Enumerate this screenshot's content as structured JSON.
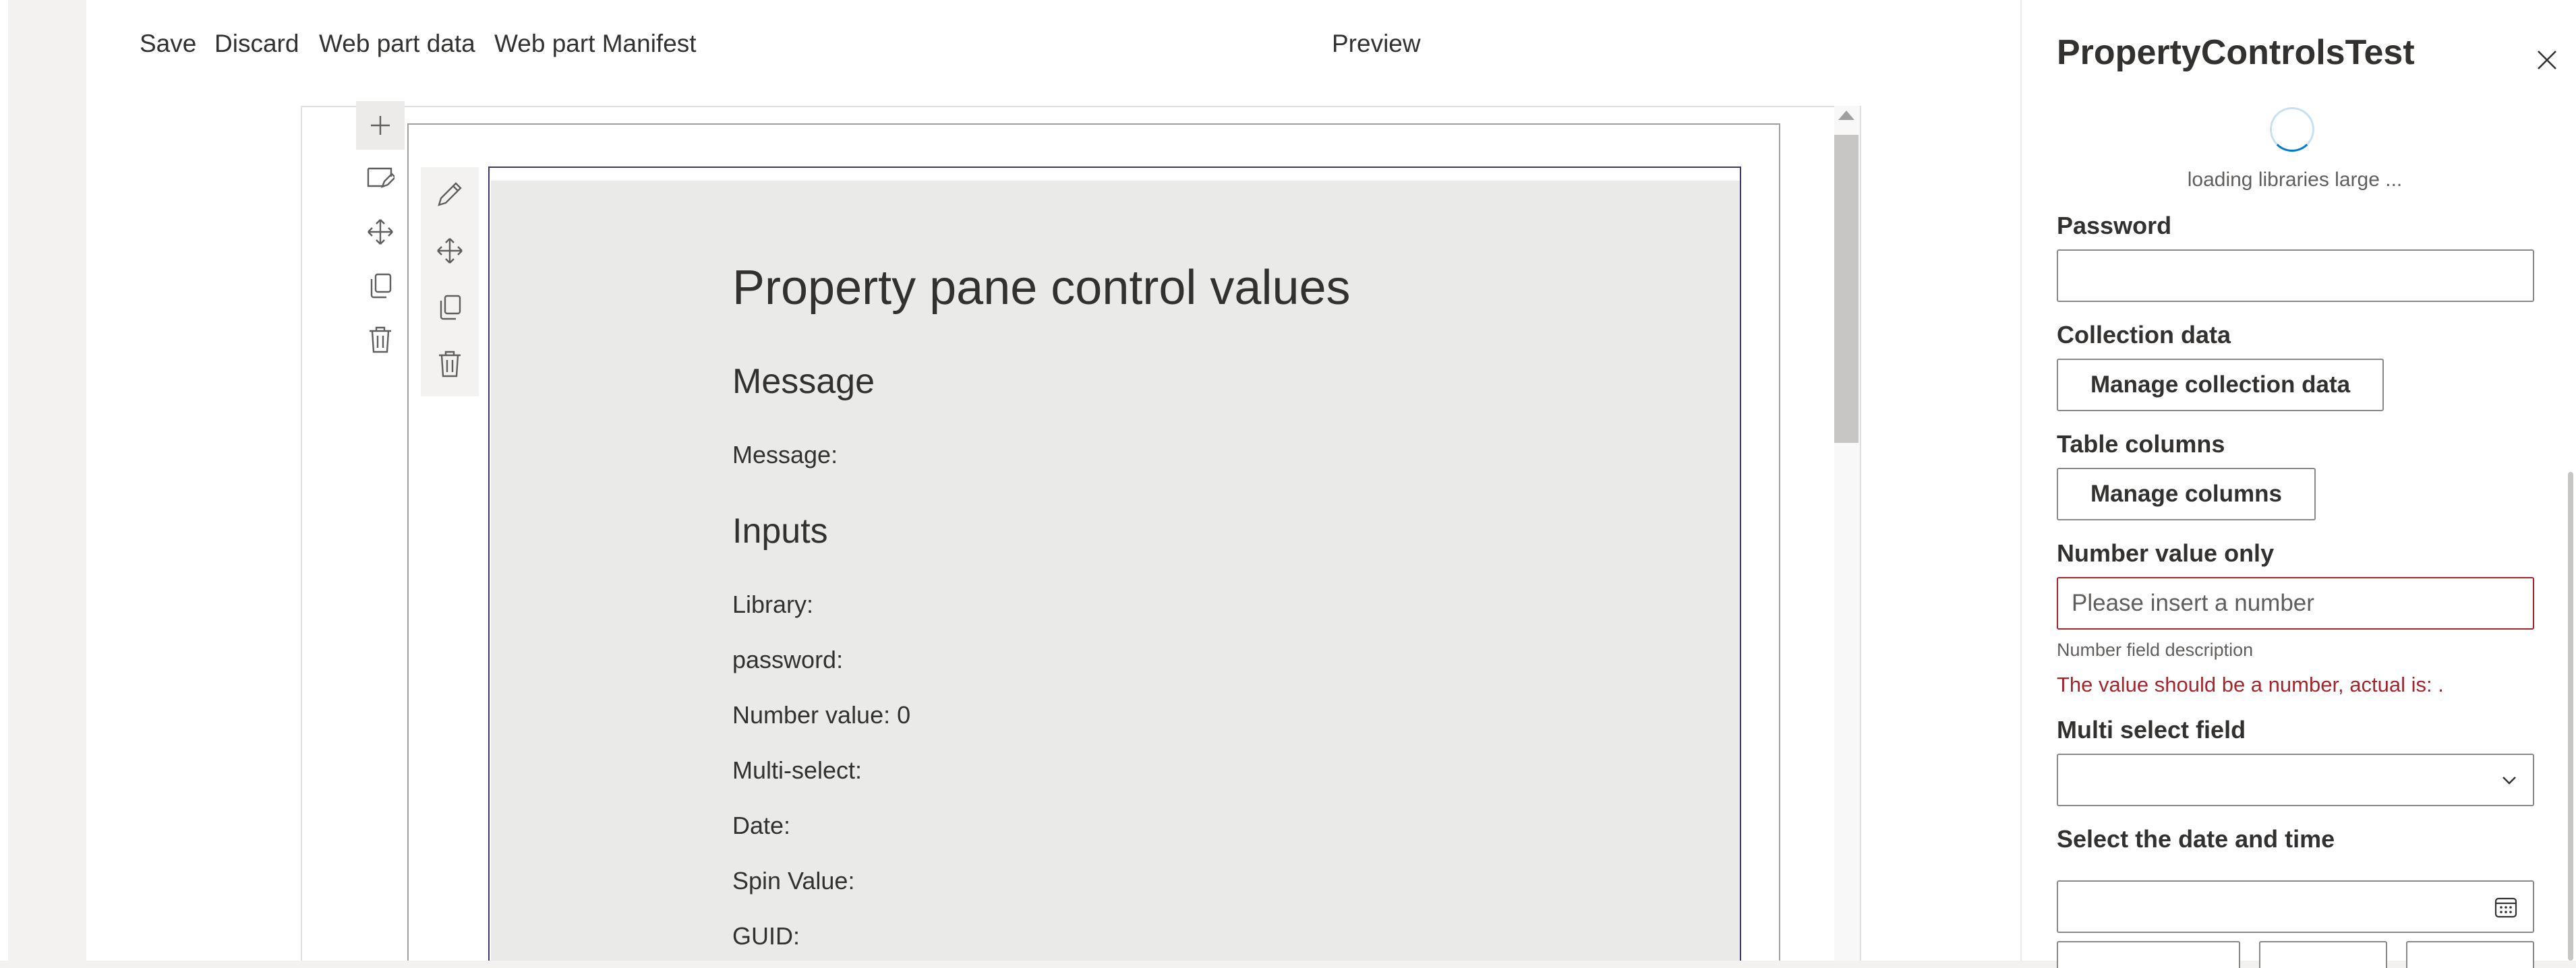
{
  "command_bar": {
    "save_label": "Save",
    "discard_label": "Discard",
    "webpart_data_label": "Web part data",
    "webpart_manifest_label": "Web part Manifest",
    "preview_label": "Preview"
  },
  "web_part": {
    "title": "Property pane control values",
    "message_heading": "Message",
    "message_row": "Message:",
    "inputs_heading": "Inputs",
    "rows": [
      "Library:",
      "password:",
      "Number value: 0",
      "Multi-select:",
      "Date:",
      "Spin Value:",
      "GUID:"
    ]
  },
  "property_pane": {
    "title": "PropertyControlsTest",
    "loading_text": "loading libraries large ...",
    "password_label": "Password",
    "password_value": "",
    "collection_label": "Collection data",
    "collection_button": "Manage collection data",
    "table_columns_label": "Table columns",
    "table_columns_button": "Manage columns",
    "number_label": "Number value only",
    "number_placeholder": "Please insert a number",
    "number_description": "Number field description",
    "number_error": "The value should be a number, actual is: .",
    "multiselect_label": "Multi select field",
    "multiselect_value": "",
    "date_label": "Select the date and time",
    "date_value": ""
  },
  "colors": {
    "accent": "#0078d4",
    "error": "#a4262c",
    "webpart_border": "#3b3a69",
    "webpart_background": "#eaeae8"
  },
  "icons": {
    "section_toolbar": [
      "add-icon",
      "edit-section-icon",
      "move-icon",
      "duplicate-icon",
      "delete-icon"
    ],
    "webpart_toolbar": [
      "edit-icon",
      "move-icon",
      "duplicate-icon",
      "delete-icon"
    ],
    "pane": [
      "close-icon",
      "chevron-down-icon",
      "calendar-icon"
    ]
  }
}
